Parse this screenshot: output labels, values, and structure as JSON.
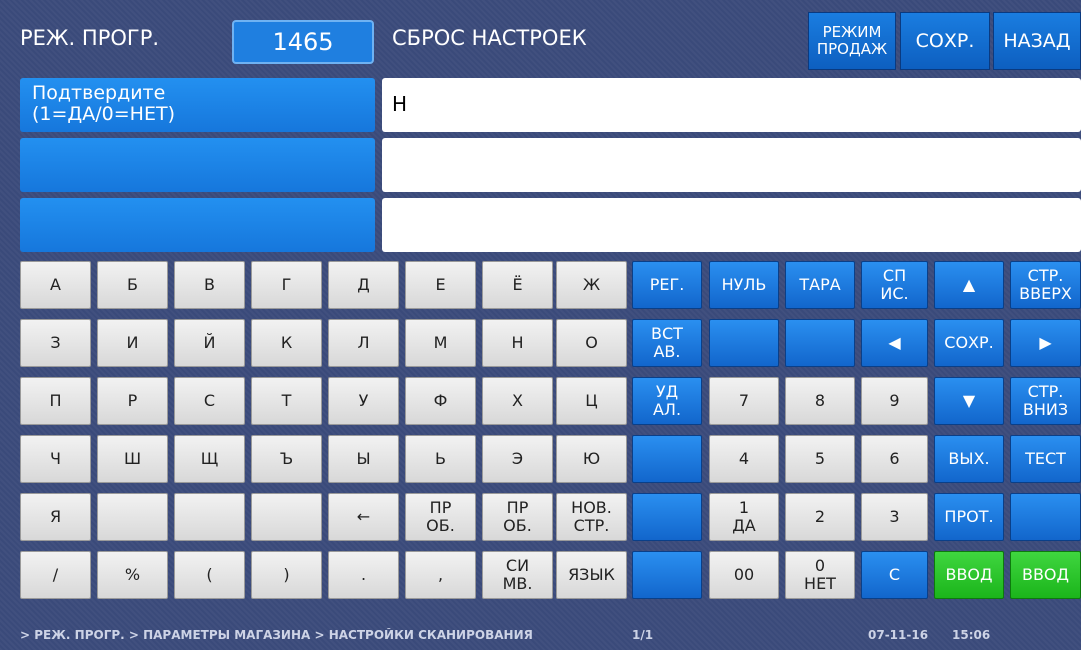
{
  "header": {
    "mode_title": "РЕЖ. ПРОГР.",
    "code": "1465",
    "function_title": "СБРОС НАСТРОЕК",
    "btn_sales_mode": "РЕЖИМ\nПРОДАЖ",
    "btn_save": "СОХР.",
    "btn_back": "НАЗАД"
  },
  "fields": [
    {
      "label": "Подтвердите\n(1=ДА/0=НЕТ)",
      "value": "Н"
    },
    {
      "label": "",
      "value": ""
    },
    {
      "label": "",
      "value": ""
    }
  ],
  "keys": {
    "r0": [
      "А",
      "Б",
      "В",
      "Г",
      "Д",
      "Е",
      "Ё",
      "Ж",
      "РЕГ.",
      "НУЛЬ",
      "ТАРА",
      "СП\nИС.",
      "▲",
      "СТР.\nВВЕРХ"
    ],
    "r1": [
      "З",
      "И",
      "Й",
      "К",
      "Л",
      "М",
      "Н",
      "О",
      "ВСТ\nАВ.",
      "",
      "",
      "◀",
      "СОХР.",
      "▶"
    ],
    "r2": [
      "П",
      "Р",
      "С",
      "Т",
      "У",
      "Ф",
      "Х",
      "Ц",
      "УД\nАЛ.",
      "7",
      "8",
      "9",
      "▼",
      "СТР.\nВНИЗ"
    ],
    "r3": [
      "Ч",
      "Ш",
      "Щ",
      "Ъ",
      "Ы",
      "Ь",
      "Э",
      "Ю",
      "",
      "4",
      "5",
      "6",
      "ВЫХ.",
      "ТЕСТ"
    ],
    "r4": [
      "Я",
      "",
      "",
      "",
      "←",
      "ПР\nОБ.",
      "ПР\nОБ.",
      "НОВ.\nСТР.",
      "",
      "1\nДА",
      "2",
      "3",
      "ПРОТ.",
      ""
    ],
    "r5": [
      "/",
      "%",
      "(",
      ")",
      ".",
      ",",
      "СИ\nМВ.",
      "ЯЗЫК",
      "",
      "00",
      "0\nНЕТ",
      "С",
      "ВВОД",
      "ВВОД"
    ]
  },
  "status": {
    "path": "> РЕЖ. ПРОГР. > ПАРАМЕТРЫ МАГАЗИНА > НАСТРОЙКИ СКАНИРОВАНИЯ",
    "page": "1/1",
    "date": "07-11-16",
    "time": "15:06"
  },
  "colors": {
    "background": "#3a4a7a",
    "key_blue": "#1a7de0",
    "key_gray": "#e6e6e6",
    "key_green": "#22c022",
    "field_label": "#1e86ea",
    "field_value": "#ffffff"
  }
}
